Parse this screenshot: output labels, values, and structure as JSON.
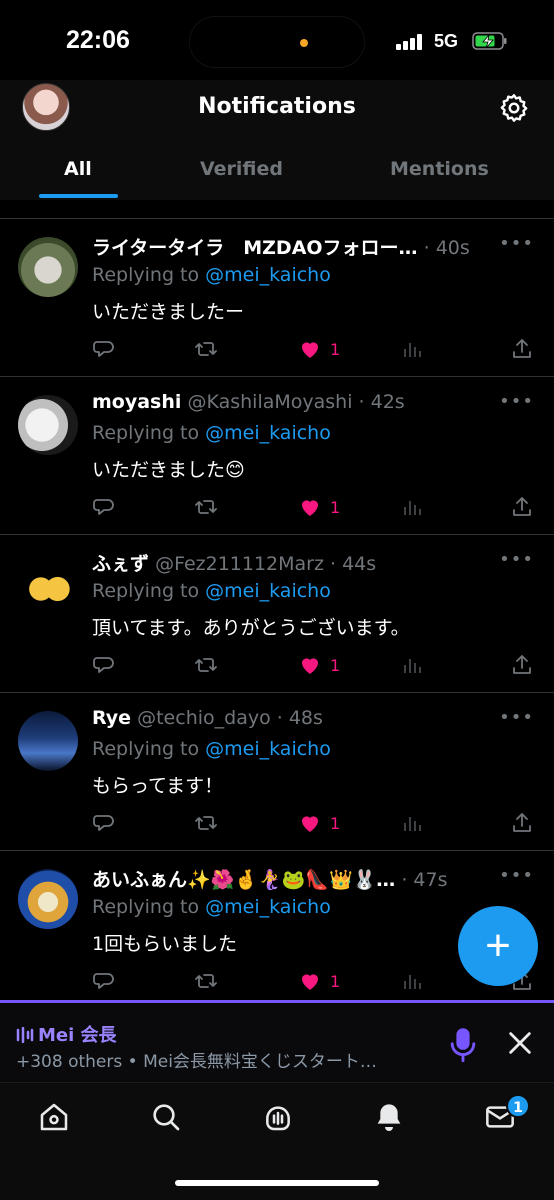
{
  "status_bar": {
    "time": "22:06",
    "network": "5G"
  },
  "header": {
    "title": "Notifications",
    "tabs": [
      {
        "label": "All",
        "active": true
      },
      {
        "label": "Verified",
        "active": false
      },
      {
        "label": "Mentions",
        "active": false
      }
    ]
  },
  "tweets": [
    {
      "name": "ライタータイラ　MZDAOフォロー…",
      "handle": "",
      "time": "40s",
      "replying_prefix": "Replying to ",
      "replying_to": "@mei_kaicho",
      "text": "いただきましたー",
      "likes": "1"
    },
    {
      "name": "moyashi",
      "handle": "@KashilaMoyashi",
      "time": "42s",
      "replying_prefix": "Replying to ",
      "replying_to": "@mei_kaicho",
      "text": "いただきました😊",
      "likes": "1"
    },
    {
      "name": "ふぇず",
      "handle": "@Fez211112Marz",
      "time": "44s",
      "replying_prefix": "Replying to ",
      "replying_to": "@mei_kaicho",
      "text": "頂いてます。ありがとうございます。",
      "likes": "1"
    },
    {
      "name": "Rye",
      "handle": "@techio_dayo",
      "time": "48s",
      "replying_prefix": "Replying to ",
      "replying_to": "@mei_kaicho",
      "text": "もらってます！",
      "likes": "1"
    },
    {
      "name": "あいふぁん✨🌺🤞🧜‍♀️🐸👠👑🐰…",
      "handle": "",
      "time": "47s",
      "replying_prefix": "Replying to ",
      "replying_to": "@mei_kaicho",
      "text": "1回もらいました",
      "likes": "1"
    }
  ],
  "fab": {
    "label": "+"
  },
  "space": {
    "host": "Mei 会長",
    "subtitle": "+308 others • Mei会長無料宝くじスタート…"
  },
  "bottom_nav": {
    "items": [
      "home-icon",
      "search-icon",
      "spaces-icon",
      "notifications-icon",
      "messages-icon"
    ],
    "messages_badge": "1"
  },
  "colors": {
    "accent": "#1d9bf0",
    "like": "#f91880",
    "space": "#7856ff",
    "muted": "#71767b"
  }
}
